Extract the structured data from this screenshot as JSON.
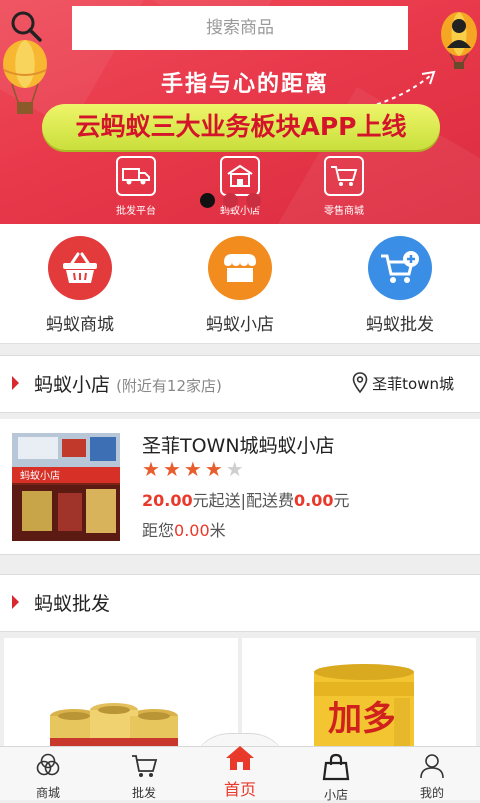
{
  "search": {
    "placeholder": "搜索商品"
  },
  "banner": {
    "tagline": "手指与心的距离",
    "headline": "云蚂蚁三大业务板块APP上线",
    "items": [
      {
        "label": "批发平台",
        "icon": "truck-icon"
      },
      {
        "label": "蚂蚁小店",
        "icon": "shop-icon"
      },
      {
        "label": "零售商城",
        "icon": "cart-icon"
      }
    ],
    "active_slide": 1,
    "slide_count": 3
  },
  "categories": [
    {
      "label": "蚂蚁商城",
      "color": "#e33a3c",
      "icon": "basket-icon"
    },
    {
      "label": "蚂蚁小店",
      "color": "#f28c1e",
      "icon": "store-icon"
    },
    {
      "label": "蚂蚁批发",
      "color": "#3a8ee6",
      "icon": "cart-add-icon"
    }
  ],
  "shop_section": {
    "title": "蚂蚁小店",
    "subtitle": "(附近有12家店)",
    "location": "圣菲town城",
    "location_icon": "location-pin-icon"
  },
  "store": {
    "name": "圣菲TOWN城蚂蚁小店",
    "rating": 4,
    "rating_max": 5,
    "min_order_value": "20.00",
    "min_order_suffix": "元起送",
    "separator": "|配送费",
    "delivery_fee": "0.00",
    "fee_suffix": "元",
    "distance_prefix": "距您",
    "distance_value": "0.00",
    "distance_suffix": "米",
    "image_sign_text": "蚂蚁小店"
  },
  "wholesale_section": {
    "title": "蚂蚁批发"
  },
  "products": [
    {
      "icon": "gold-cans-icon"
    },
    {
      "icon": "gold-can-icon",
      "label": "加多"
    }
  ],
  "nav": [
    {
      "label": "商城",
      "icon": "mall-icon",
      "active": false
    },
    {
      "label": "批发",
      "icon": "cart-icon",
      "active": false
    },
    {
      "label": "首页",
      "icon": "home-icon",
      "active": true
    },
    {
      "label": "小店",
      "icon": "bag-icon",
      "active": false
    },
    {
      "label": "我的",
      "icon": "person-icon",
      "active": false
    }
  ],
  "colors": {
    "brand_red": "#e8392b",
    "banner_red": "#e8394b",
    "accent_yellow": "#d9e64f"
  }
}
